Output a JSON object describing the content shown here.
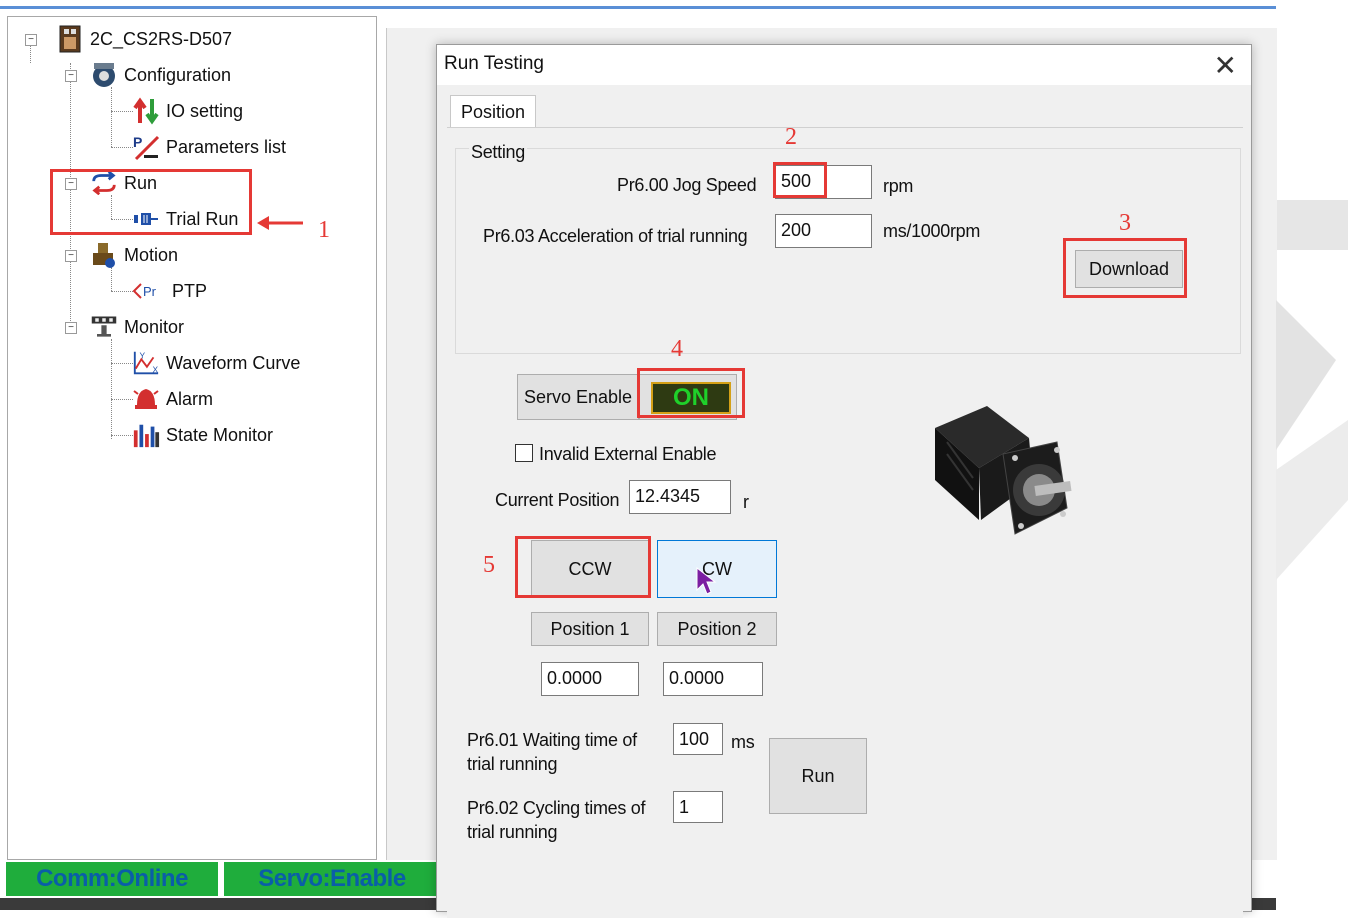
{
  "tree": {
    "root": "2C_CS2RS-D507",
    "configuration": "Configuration",
    "io_setting": "IO setting",
    "parameters_list": "Parameters list",
    "run": "Run",
    "trial_run": "Trial Run",
    "motion": "Motion",
    "ptp": "PTP",
    "monitor": "Monitor",
    "waveform_curve": "Waveform Curve",
    "alarm": "Alarm",
    "state_monitor": "State Monitor"
  },
  "status": {
    "comm": "Comm:Online",
    "servo": "Servo:Enable"
  },
  "dialog": {
    "title": "Run Testing",
    "close": "✕",
    "tab": "Position",
    "setting_group": "Setting",
    "jog_speed_label": "Pr6.00 Jog Speed",
    "jog_speed_value": "500",
    "jog_speed_unit": "rpm",
    "accel_label": "Pr6.03 Acceleration of trial running",
    "accel_value": "200",
    "accel_unit": "ms/1000rpm",
    "download_button": "Download",
    "servo_enable_button": "Servo Enable",
    "servo_state": "ON",
    "invalid_external_enable": "Invalid External Enable",
    "invalid_external_enable_checked": false,
    "current_position_label": "Current Position",
    "current_position_value": "12.4345",
    "current_position_unit": "r",
    "ccw_button": "CCW",
    "cw_button": "CW",
    "position1_button": "Position 1",
    "position2_button": "Position 2",
    "position1_value": "0.0000",
    "position2_value": "0.0000",
    "waiting_time_label_1": "Pr6.01 Waiting time of",
    "waiting_time_label_2": "trial running",
    "waiting_time_value": "100",
    "waiting_time_unit": "ms",
    "cycling_times_label_1": "Pr6.02 Cycling times of",
    "cycling_times_label_2": "trial running",
    "cycling_times_value": "1",
    "run_button": "Run"
  },
  "annotations": {
    "step1": "1",
    "step2": "2",
    "step3": "3",
    "step4": "4",
    "step5": "5",
    "color": "#e53935"
  },
  "colors": {
    "status_green": "#1fad3c",
    "status_text": "#0a5ea8",
    "on_text": "#1fd12a",
    "title_accent": "#5a8fd6"
  }
}
